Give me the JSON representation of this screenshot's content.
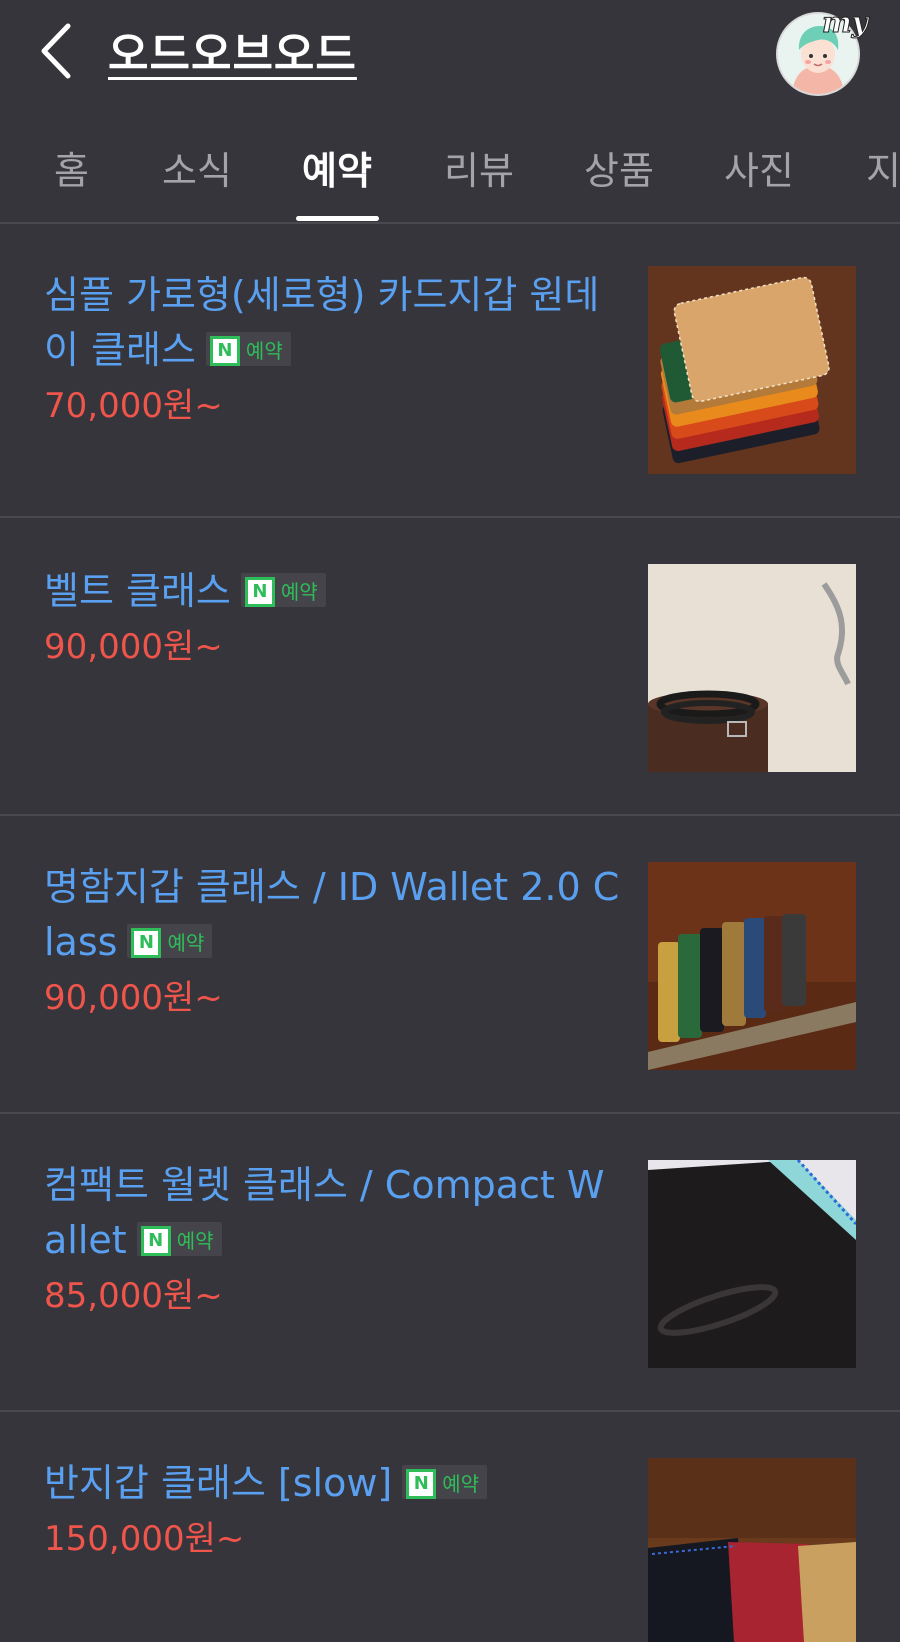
{
  "header": {
    "title": "오드오브오드",
    "my_label": "my"
  },
  "tabs": [
    {
      "label": "홈"
    },
    {
      "label": "소식"
    },
    {
      "label": "예약"
    },
    {
      "label": "리뷰"
    },
    {
      "label": "상품"
    },
    {
      "label": "사진"
    },
    {
      "label": "지"
    }
  ],
  "active_tab": "예약",
  "badge": {
    "icon": "N",
    "label": "예약"
  },
  "items": [
    {
      "title": "심플 가로형(세로형) 카드지갑 원데이 클래스",
      "price": "70,000원~"
    },
    {
      "title": "벨트 클래스",
      "price": "90,000원~"
    },
    {
      "title": "명함지갑 클래스 / ID Wallet 2.0 Class",
      "price": "90,000원~"
    },
    {
      "title": "컴팩트 월렛 클래스 / Compact Wallet",
      "price": "85,000원~"
    },
    {
      "title": "반지갑 클래스 [slow]",
      "price": "150,000원~"
    }
  ],
  "colors": {
    "background": "#36353b",
    "title_link": "#5aa0f0",
    "price": "#f0554c",
    "badge_green": "#2ebd59"
  }
}
